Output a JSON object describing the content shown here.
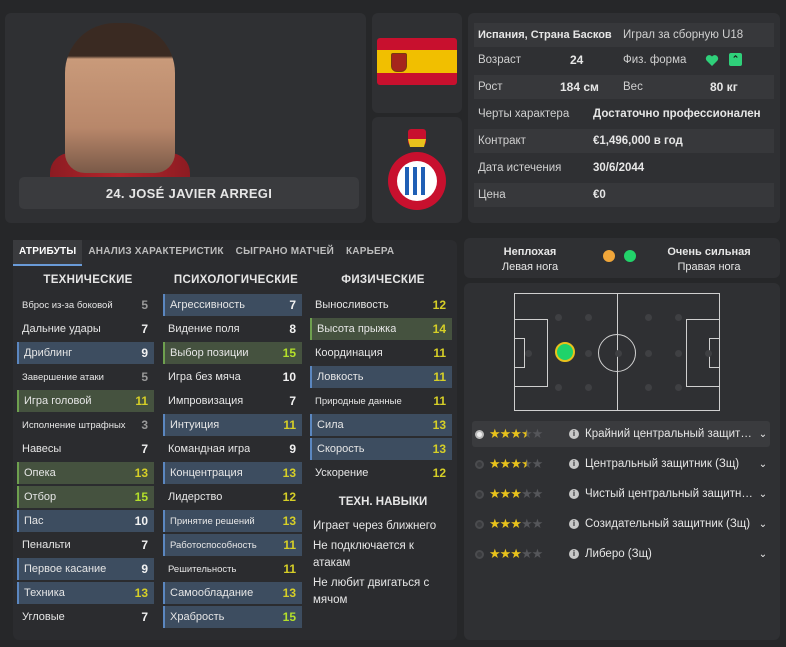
{
  "player": {
    "name": "24. JOSÉ JAVIER ARREGI"
  },
  "info": {
    "nationality": "Испания, Страна Басков",
    "international": "Играл за сборную U18",
    "age_label": "Возраст",
    "age_value": "24",
    "fitness_label": "Физ. форма",
    "height_label": "Рост",
    "height_value": "184 см",
    "weight_label": "Вес",
    "weight_value": "80 кг",
    "traits_label": "Черты характера",
    "traits_value": "Достаточно профессионален",
    "contract_label": "Контракт",
    "contract_value": "€1,496,000 в год",
    "expiry_label": "Дата истечения",
    "expiry_value": "30/6/2044",
    "price_label": "Цена",
    "price_value": "€0"
  },
  "tabs": [
    "АТРИБУТЫ",
    "АНАЛИЗ ХАРАКТЕРИСТИК",
    "СЫГРАНО МАТЧЕЙ",
    "КАРЬЕРА"
  ],
  "columns": {
    "technical_title": "ТЕХНИЧЕСКИЕ",
    "mental_title": "ПСИХОЛОГИЧЕСКИЕ",
    "physical_title": "ФИЗИЧЕСКИЕ"
  },
  "technical": [
    {
      "label": "Вброс из-за боковой",
      "value": "5"
    },
    {
      "label": "Дальние удары",
      "value": "7"
    },
    {
      "label": "Дриблинг",
      "value": "9"
    },
    {
      "label": "Завершение атаки",
      "value": "5"
    },
    {
      "label": "Игра головой",
      "value": "11"
    },
    {
      "label": "Исполнение штрафных",
      "value": "3"
    },
    {
      "label": "Навесы",
      "value": "7"
    },
    {
      "label": "Опека",
      "value": "13"
    },
    {
      "label": "Отбор",
      "value": "15"
    },
    {
      "label": "Пас",
      "value": "10"
    },
    {
      "label": "Пенальти",
      "value": "7"
    },
    {
      "label": "Первое касание",
      "value": "9"
    },
    {
      "label": "Техника",
      "value": "13"
    },
    {
      "label": "Угловые",
      "value": "7"
    }
  ],
  "mental": [
    {
      "label": "Агрессивность",
      "value": "7"
    },
    {
      "label": "Видение поля",
      "value": "8"
    },
    {
      "label": "Выбор позиции",
      "value": "15"
    },
    {
      "label": "Игра без мяча",
      "value": "10"
    },
    {
      "label": "Импровизация",
      "value": "7"
    },
    {
      "label": "Интуиция",
      "value": "11"
    },
    {
      "label": "Командная игра",
      "value": "9"
    },
    {
      "label": "Концентрация",
      "value": "13"
    },
    {
      "label": "Лидерство",
      "value": "12"
    },
    {
      "label": "Принятие решений",
      "value": "13"
    },
    {
      "label": "Работоспособность",
      "value": "11"
    },
    {
      "label": "Решительность",
      "value": "11"
    },
    {
      "label": "Самообладание",
      "value": "13"
    },
    {
      "label": "Храбрость",
      "value": "15"
    }
  ],
  "physical": [
    {
      "label": "Выносливость",
      "value": "12"
    },
    {
      "label": "Высота прыжка",
      "value": "14"
    },
    {
      "label": "Координация",
      "value": "11"
    },
    {
      "label": "Ловкость",
      "value": "11"
    },
    {
      "label": "Природные данные",
      "value": "11"
    },
    {
      "label": "Сила",
      "value": "13"
    },
    {
      "label": "Скорость",
      "value": "13"
    },
    {
      "label": "Ускорение",
      "value": "12"
    }
  ],
  "tech_skills": {
    "title": "ТЕХН. НАВЫКИ",
    "items": [
      "Играет через ближнего",
      "Не подключается к атакам",
      "Не любит двигаться с мячом"
    ]
  },
  "feet": {
    "left_rating": "Неплохая",
    "left_label": "Левая нога",
    "right_rating": "Очень сильная",
    "right_label": "Правая нога",
    "left_color": "#f0a63a",
    "right_color": "#22d36a"
  },
  "roles": [
    {
      "name": "Крайний центральный защитник (Зщ)",
      "stars": 3.5,
      "selected": true
    },
    {
      "name": "Центральный защитник (Зщ)",
      "stars": 3.5,
      "selected": false
    },
    {
      "name": "Чистый центральный защитник (Зщ)",
      "stars": 3,
      "selected": false
    },
    {
      "name": "Созидательный защитник (Зщ)",
      "stars": 3,
      "selected": false
    },
    {
      "name": "Либеро (Зщ)",
      "stars": 3,
      "selected": false
    }
  ]
}
